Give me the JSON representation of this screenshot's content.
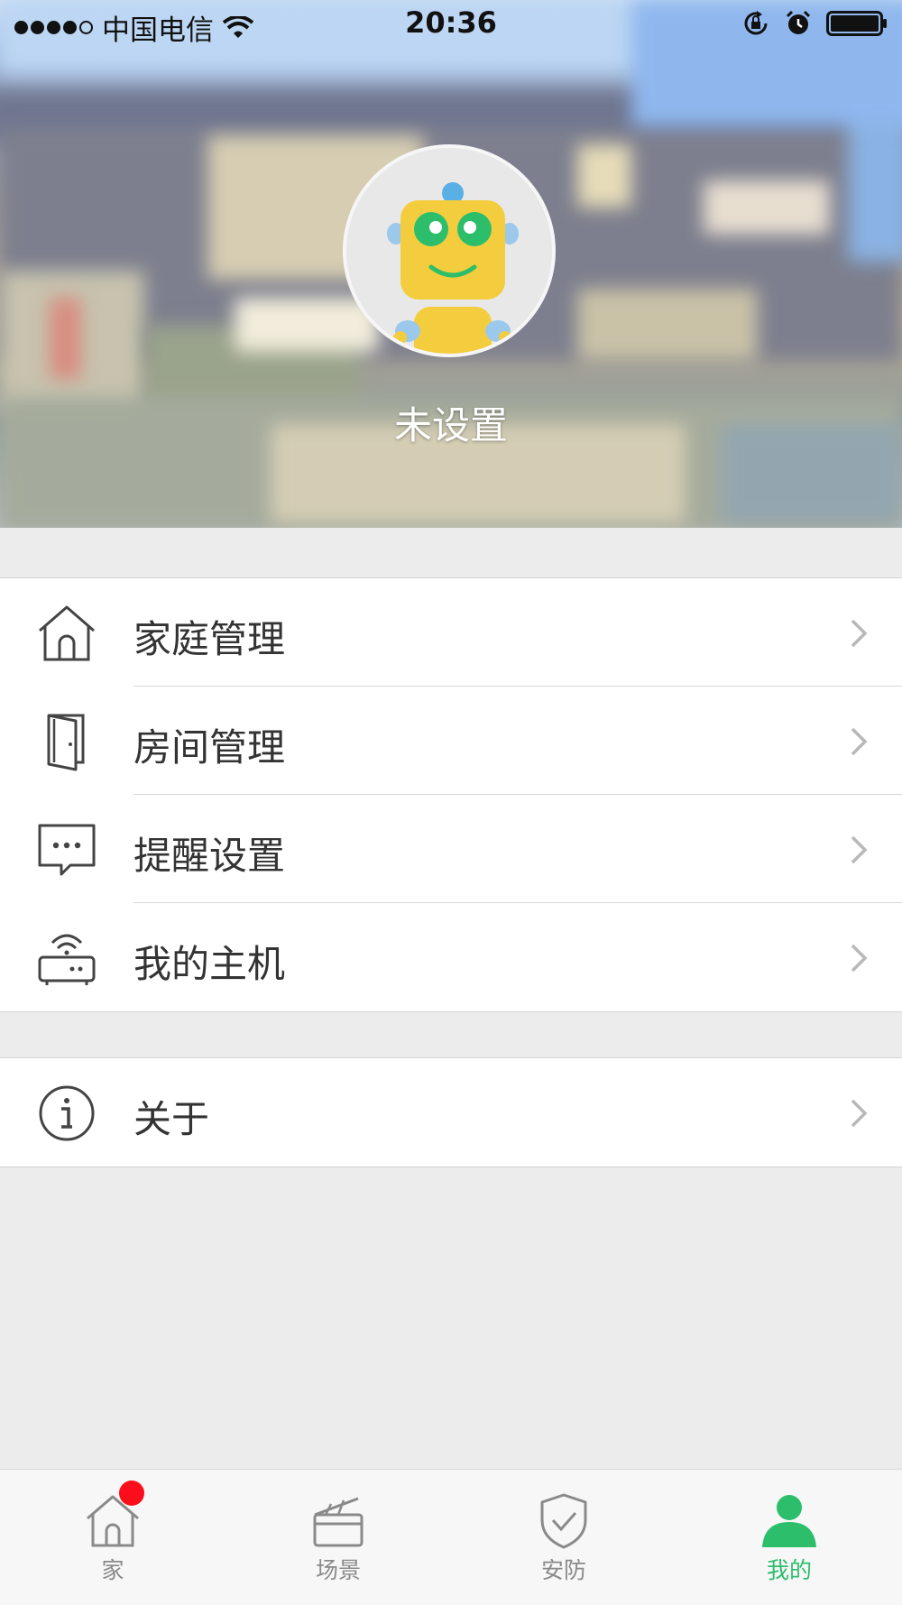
{
  "status_bar": {
    "carrier": "中国电信",
    "time": "20:36",
    "signal_bars_filled": 4,
    "signal_bars_total": 5
  },
  "profile": {
    "nickname": "未设置",
    "avatar": "robot-avatar"
  },
  "menu_groups": [
    {
      "items": [
        {
          "label": "家庭管理",
          "icon": "house-icon"
        },
        {
          "label": "房间管理",
          "icon": "door-icon"
        },
        {
          "label": "提醒设置",
          "icon": "message-icon"
        },
        {
          "label": "我的主机",
          "icon": "router-icon"
        }
      ]
    },
    {
      "items": [
        {
          "label": "关于",
          "icon": "info-icon"
        }
      ]
    }
  ],
  "tab_bar": {
    "tabs": [
      {
        "label": "家",
        "icon": "home-tab-icon",
        "badge": true
      },
      {
        "label": "场景",
        "icon": "clapperboard-icon",
        "badge": false
      },
      {
        "label": "安防",
        "icon": "shield-check-icon",
        "badge": false
      },
      {
        "label": "我的",
        "icon": "person-icon",
        "badge": false
      }
    ],
    "active_index": 3
  },
  "colors": {
    "accent": "#2dbe6c",
    "badge": "#fc0d1b",
    "background": "#ececec"
  }
}
